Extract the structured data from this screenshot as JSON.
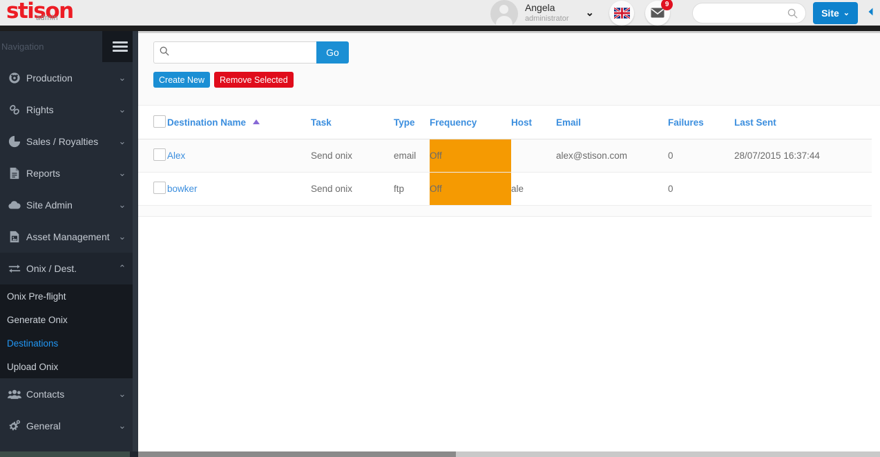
{
  "brand": {
    "name": "stison",
    "sub": "admin"
  },
  "header": {
    "user": {
      "name": "Angela",
      "role": "administrator",
      "caret": "⌄"
    },
    "language_icon": "uk-flag-icon",
    "messages": {
      "icon": "envelope-icon",
      "badge": "9"
    },
    "search": {
      "value": "",
      "placeholder": ""
    },
    "site_button": {
      "label": "Site",
      "caret": "⌄",
      "color": "#0e82cd"
    },
    "collapse_icon": "chevron-left-icon"
  },
  "sidebar": {
    "title": "Navigation",
    "menu_icon": "hamburger-icon",
    "items": [
      {
        "label": "Production",
        "icon": "dashboard-icon",
        "caret": "⌄",
        "expanded": false
      },
      {
        "label": "Rights",
        "icon": "link-icon",
        "caret": "⌄",
        "expanded": false
      },
      {
        "label": "Sales / Royalties",
        "icon": "pie-chart-icon",
        "caret": "⌄",
        "expanded": false
      },
      {
        "label": "Reports",
        "icon": "document-icon",
        "caret": "⌄",
        "expanded": false
      },
      {
        "label": "Site Admin",
        "icon": "cloud-icon",
        "caret": "⌄",
        "expanded": false
      },
      {
        "label": "Asset Management",
        "icon": "image-file-icon",
        "caret": "⌄",
        "expanded": false
      },
      {
        "label": "Onix / Dest.",
        "icon": "exchange-icon",
        "caret": "⌃",
        "expanded": true
      },
      {
        "label": "Contacts",
        "icon": "users-icon",
        "caret": "⌄",
        "expanded": false
      },
      {
        "label": "General",
        "icon": "gears-icon",
        "caret": "⌄",
        "expanded": false
      }
    ],
    "subitems": [
      {
        "label": "Onix Pre-flight",
        "selected": false
      },
      {
        "label": "Generate Onix",
        "selected": false
      },
      {
        "label": "Destinations",
        "selected": true
      },
      {
        "label": "Upload Onix",
        "selected": false
      }
    ],
    "selected_color": "#2196f3"
  },
  "main": {
    "search": {
      "value": "",
      "placeholder": "",
      "icon": "search-icon"
    },
    "go_label": "Go",
    "create_label": "Create New",
    "remove_label": "Remove Selected",
    "table": {
      "sort_column": "Destination Name",
      "sort_direction": "asc",
      "columns": [
        {
          "key": "select",
          "label": ""
        },
        {
          "key": "name",
          "label": "Destination Name"
        },
        {
          "key": "task",
          "label": "Task"
        },
        {
          "key": "type",
          "label": "Type"
        },
        {
          "key": "freq",
          "label": "Frequency"
        },
        {
          "key": "host",
          "label": "Host"
        },
        {
          "key": "email",
          "label": "Email"
        },
        {
          "key": "fail",
          "label": "Failures"
        },
        {
          "key": "sent",
          "label": "Last Sent"
        }
      ],
      "rows": [
        {
          "name": "Alex",
          "task": "Send onix",
          "type": "email",
          "freq": "Off",
          "host": "",
          "email": "alex@stison.com",
          "failures": "0",
          "last_sent": "28/07/2015 16:37:44"
        },
        {
          "name": "bowker",
          "task": "Send onix",
          "type": "ftp",
          "freq": "Off",
          "host": "ale",
          "email": "",
          "failures": "0",
          "last_sent": ""
        }
      ],
      "freq_off_color": "#f59a02",
      "link_color": "#3b8ede"
    }
  }
}
